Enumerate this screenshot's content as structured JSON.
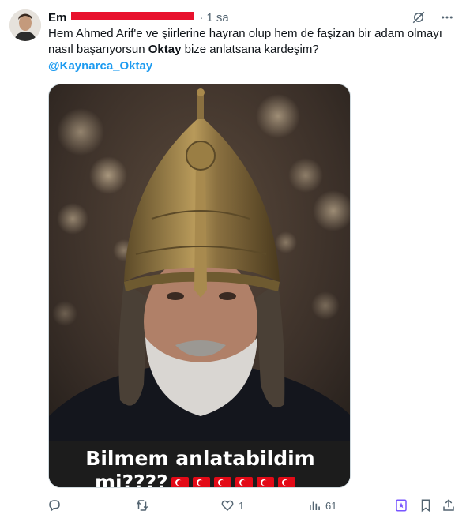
{
  "tweet": {
    "author_name": "Em",
    "separator": "·",
    "time": "1 sa",
    "text_line1": "Hem Ahmed Arif'e ve şiirlerine hayran olup hem de faşizan bir adam olmayı",
    "text_line2_pre": "nasıl başarıyorsun ",
    "text_bold": "Oktay",
    "text_line2_post": " bize  anlatsana kardeşim?",
    "mention": "@Kaynarca_Oktay",
    "image_caption_line1": "Bilmem anlatabildim",
    "image_caption_line2": "mi????",
    "flag_count": 6
  },
  "actions": {
    "reply_count": "",
    "retweet_count": "",
    "like_count": "1",
    "views_count": "61"
  },
  "icons": {
    "grok": "grok-icon",
    "more": "more-icon",
    "reply": "reply-icon",
    "retweet": "retweet-icon",
    "like": "like-icon",
    "views": "views-icon",
    "highlight": "highlight-icon",
    "bookmark": "bookmark-icon",
    "share": "share-icon"
  },
  "colors": {
    "link": "#1d9bf0",
    "muted": "#536471",
    "highlight_icon": "#7856ff",
    "redaction": "#e8112d",
    "flag_red": "#e30a17"
  }
}
